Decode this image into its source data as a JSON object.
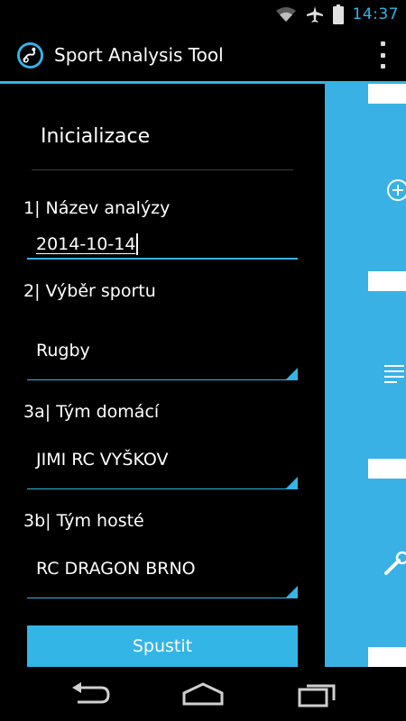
{
  "status_bar": {
    "time": "14:37",
    "icons": [
      "wifi-icon",
      "airplane-icon",
      "battery-icon"
    ]
  },
  "action_bar": {
    "title": "Sport Analysis Tool",
    "app_icon": "sport-logo-icon",
    "overflow_icon": "overflow-menu-icon"
  },
  "drawer": {
    "title": "Inicializace",
    "fields": {
      "analysis_name": {
        "label": "1| Název analýzy",
        "value": "2014-10-14"
      },
      "sport": {
        "label": "2| Výběr sportu",
        "selected": "Rugby"
      },
      "home_team": {
        "label": "3a| Tým domácí",
        "selected": "JIMI RC VYŠKOV"
      },
      "away_team": {
        "label": "3b| Tým hosté",
        "selected": "RC DRAGON BRNO"
      }
    },
    "start_button": "Spustit"
  },
  "right_panel": {
    "icons": [
      "add-circle-icon",
      "list-icon",
      "tools-icon"
    ]
  },
  "nav_bar": {
    "icons": [
      "back-icon",
      "home-icon",
      "recent-apps-icon"
    ]
  },
  "colors": {
    "accent": "#33b5e5",
    "panel": "#39b1e4",
    "background": "#000000",
    "divider": "#3a3a3a"
  }
}
